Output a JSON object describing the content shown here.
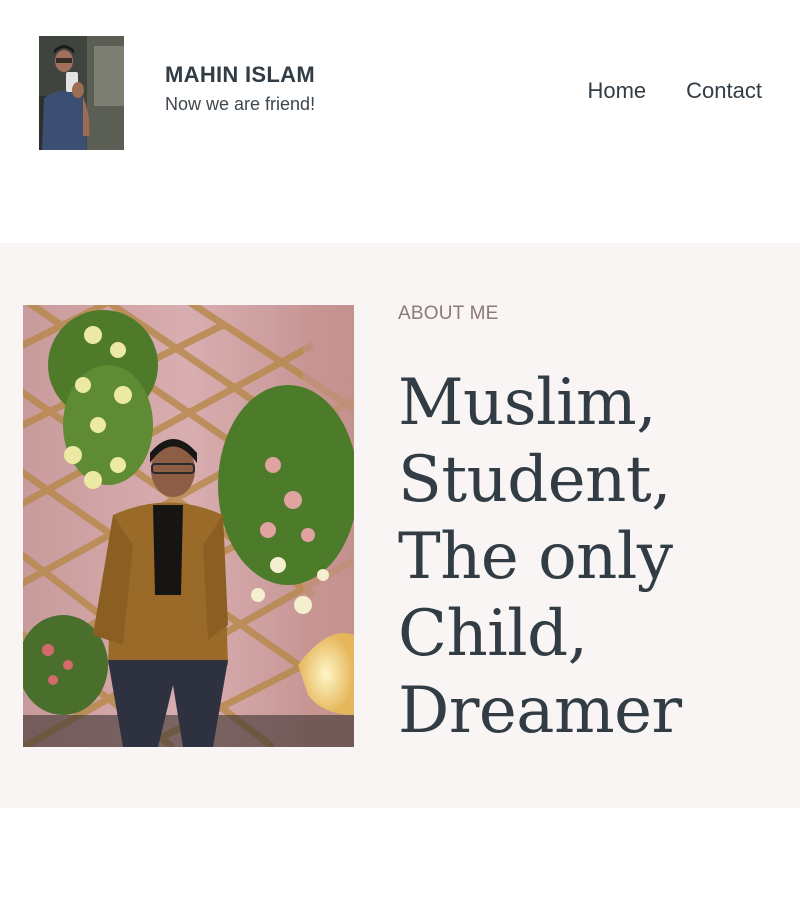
{
  "site": {
    "title": "MAHIN ISLAM",
    "tagline": "Now we are friend!"
  },
  "nav": {
    "items": [
      {
        "label": "Home"
      },
      {
        "label": "Contact"
      }
    ]
  },
  "about": {
    "eyebrow": "ABOUT ME",
    "headline": [
      "Muslim,",
      "Student,",
      "The only",
      "Child,",
      "Dreamer"
    ]
  },
  "colors": {
    "text": "#313c44",
    "eyebrow": "#8a7a78",
    "section_bg": "#f9f5f4",
    "page_bg": "#ffffff"
  }
}
